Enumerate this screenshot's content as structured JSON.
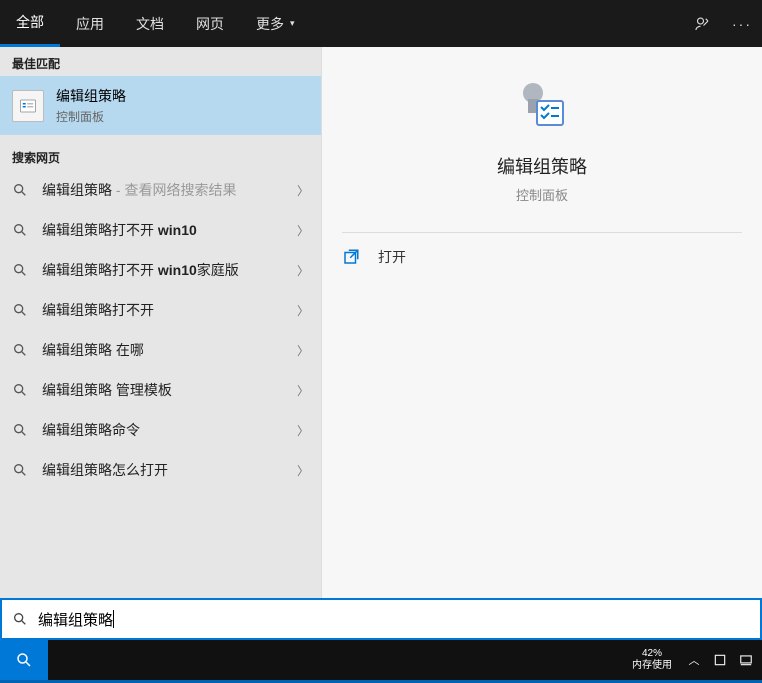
{
  "top": {
    "tabs": [
      "全部",
      "应用",
      "文档",
      "网页",
      "更多"
    ],
    "more_indicator": "▾",
    "actions": {
      "feedback": "feedback-icon",
      "menu": "more-icon"
    }
  },
  "left": {
    "best_match_header": "最佳匹配",
    "best_match": {
      "title": "编辑组策略",
      "subtitle": "控制面板"
    },
    "web_header": "搜索网页",
    "web_items": [
      {
        "text": "编辑组策略",
        "hint": " - 查看网络搜索结果"
      },
      {
        "text": "编辑组策略打不开 win10",
        "hint": ""
      },
      {
        "text": "编辑组策略打不开 win10家庭版",
        "hint": ""
      },
      {
        "text": "编辑组策略打不开",
        "hint": ""
      },
      {
        "text": "编辑组策略 在哪",
        "hint": ""
      },
      {
        "text": "编辑组策略 管理模板",
        "hint": ""
      },
      {
        "text": "编辑组策略命令",
        "hint": ""
      },
      {
        "text": "编辑组策略怎么打开",
        "hint": ""
      }
    ]
  },
  "right": {
    "title": "编辑组策略",
    "subtitle": "控制面板",
    "open_label": "打开"
  },
  "search": {
    "value": "编辑组策略"
  },
  "taskbar": {
    "mem_percent": "42%",
    "mem_label": "内存使用"
  }
}
